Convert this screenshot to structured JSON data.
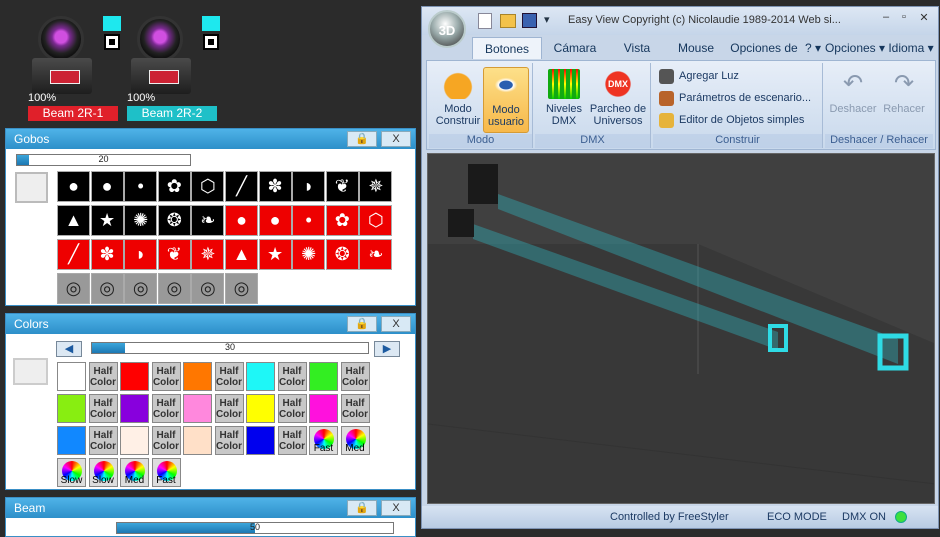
{
  "fixtures": [
    {
      "percent": "100%",
      "label": "Beam 2R-1",
      "color": "#e0202a"
    },
    {
      "percent": "100%",
      "label": "Beam 2R-2",
      "color": "#1ec0c8"
    }
  ],
  "gobos": {
    "title": "Gobos",
    "lock": "🔒",
    "close": "X",
    "value": "20",
    "fill": 0.07
  },
  "colors": {
    "title": "Colors",
    "lock": "🔒",
    "close": "X",
    "value": "30",
    "fill": 0.12,
    "half": "Half",
    "color_word": "Color",
    "swatches": [
      "#ffffff",
      "#ff0000",
      "#ff7700",
      "#1ef7f7",
      "#33ee22",
      "#88ee11",
      "#8800dd",
      "#ff88dd",
      "#ffff00",
      "#ff11dd",
      "#1188ff",
      "#fff0e6",
      "#ffe0c8",
      "#0000ee"
    ],
    "fast": "Fast",
    "med": "Med",
    "slow": "Slow"
  },
  "beam": {
    "title": "Beam",
    "lock": "🔒",
    "close": "X",
    "value": "50",
    "fill": 0.5
  },
  "window": {
    "title_text": "Easy View   Copyright (c) Nicolaudie 1989-2014   Web si...",
    "logo": "3D",
    "tabs": [
      "Botones esta",
      "Cámara",
      "Vista",
      "Mouse",
      "Opciones de",
      "? ▾",
      "Opciones ▾",
      "Idioma ▾"
    ],
    "groups": {
      "modo": "Modo",
      "dmx": "DMX",
      "construir": "Construir",
      "deshacer": "Deshacer / Rehacer"
    },
    "buttons": {
      "construir": "Modo Construir",
      "usuario": "Modo usuario",
      "niveles": "Niveles DMX",
      "parcheo": "Parcheo de Universos",
      "deshacer": "Deshacer",
      "rehacer": "Rehacer"
    },
    "small": [
      "Agregar Luz",
      "Parámetros de escenario...",
      "Editor de Objetos simples"
    ],
    "status": [
      "Controlled by FreeStyler",
      "ECO MODE",
      "DMX ON"
    ]
  }
}
